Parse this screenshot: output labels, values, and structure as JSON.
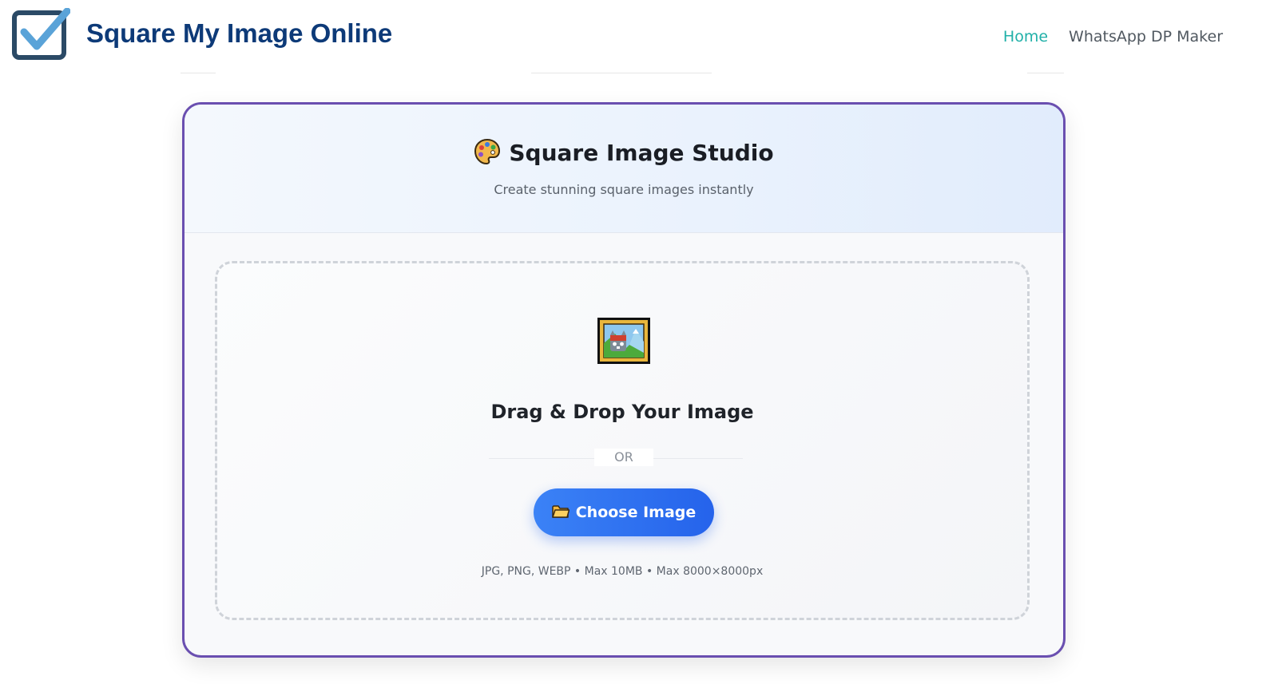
{
  "header": {
    "site_title": "Square My Image Online",
    "logo_icon": "checkbox-checked-icon",
    "nav": [
      {
        "label": "Home",
        "active": true
      },
      {
        "label": "WhatsApp DP Maker",
        "active": false
      }
    ]
  },
  "studio": {
    "title_icon": "palette-icon",
    "title": "Square Image Studio",
    "subtitle": "Create stunning square images instantly"
  },
  "upload": {
    "icon": "framed-picture-icon",
    "heading": "Drag & Drop Your Image",
    "divider_text": "OR",
    "button_icon": "folder-icon",
    "button_label": "Choose Image",
    "formats_hint": "JPG, PNG, WEBP • Max 10MB • Max 8000×8000px"
  },
  "colors": {
    "brand_title": "#0d3a78",
    "nav_active": "#20b0a8",
    "card_border": "#6a4fb0",
    "button": "#2563eb"
  }
}
